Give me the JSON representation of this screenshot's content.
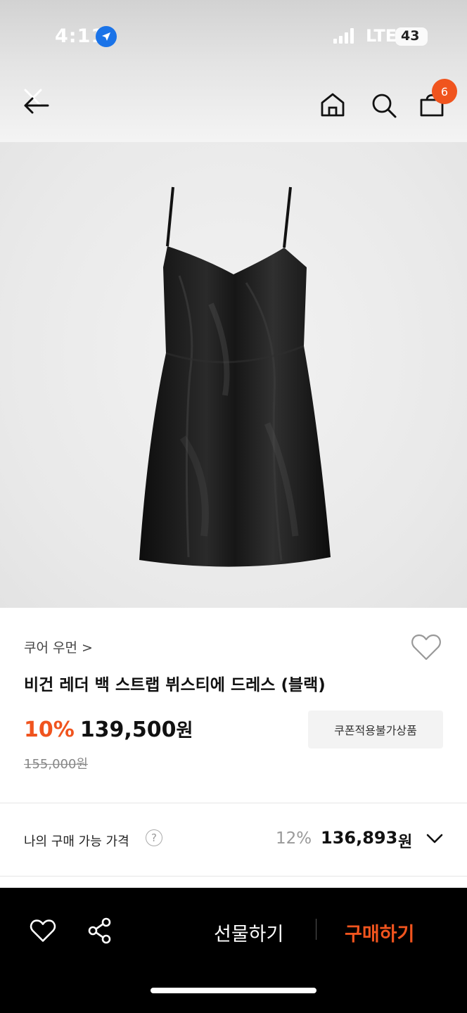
{
  "status_bar": {
    "time": "4:11",
    "network": "LTE",
    "battery": "43"
  },
  "header": {
    "cart_count": "6"
  },
  "product": {
    "brand": "쿠어 우먼 >",
    "title": "비건 레더 백 스트랩 뷔스티에 드레스 (블랙)",
    "discount": "10%",
    "price": "139,500",
    "price_unit": "원",
    "coupon_note": "쿠폰적용불가상품",
    "original_price": "155,000원"
  },
  "my_price": {
    "label": "나의 구매 가능 가격",
    "help_icon_text": "?",
    "rate": "12%",
    "value": "136,893",
    "unit": "원"
  },
  "bottom_bar": {
    "gift_label": "선물하기",
    "buy_label": "구매하기"
  },
  "colors": {
    "accent": "#f0541e",
    "bottom_bar_bg": "#000000"
  }
}
